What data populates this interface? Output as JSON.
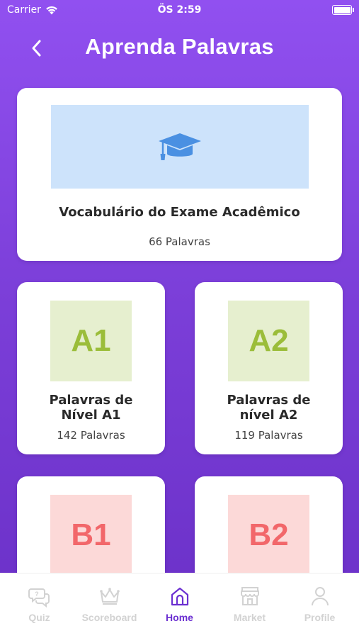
{
  "status_bar": {
    "carrier": "Carrier",
    "time": "ÖS 2:59"
  },
  "header": {
    "title": "Aprenda Palavras"
  },
  "hero_card": {
    "icon": "graduation-cap-icon",
    "title": "Vocabulário do Exame Acadêmico",
    "count": "66 Palavras"
  },
  "level_cards": [
    {
      "level": "A1",
      "title_line1": "Palavras de",
      "title_line2": "Nível A1",
      "count": "142 Palavras",
      "color": "#9bbd3a"
    },
    {
      "level": "A2",
      "title_line1": "Palavras de",
      "title_line2": "nível A2",
      "count": "119 Palavras",
      "color": "#9bbd3a"
    },
    {
      "level": "B1",
      "color": "#f2676a"
    },
    {
      "level": "B2",
      "color": "#f2676a"
    }
  ],
  "tabs": [
    {
      "label": "Quiz",
      "icon": "quiz-icon"
    },
    {
      "label": "Scoreboard",
      "icon": "crown-icon"
    },
    {
      "label": "Home",
      "icon": "home-icon",
      "active": true
    },
    {
      "label": "Market",
      "icon": "store-icon"
    },
    {
      "label": "Profile",
      "icon": "person-icon"
    }
  ],
  "colors": {
    "accent": "#6b2fd1",
    "bg_top": "#9150f0",
    "bg_bottom": "#6a30c7",
    "hero_banner": "#cde3fb",
    "cap_icon": "#4a90e2"
  }
}
